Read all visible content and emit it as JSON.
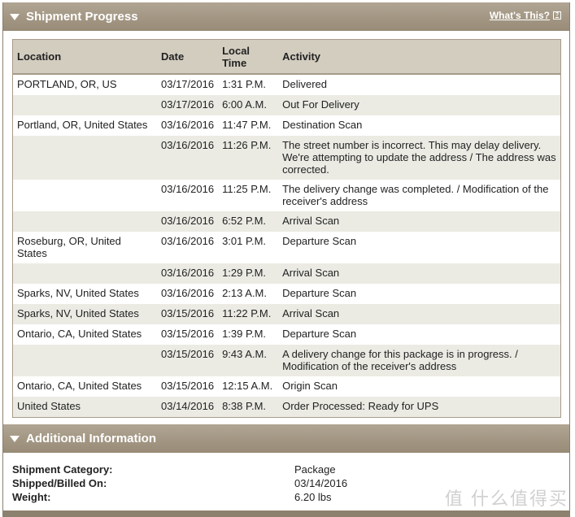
{
  "shipment_progress": {
    "title": "Shipment Progress",
    "whats_this": "What's This?",
    "headers": {
      "location": "Location",
      "date": "Date",
      "time": "Local Time",
      "activity": "Activity"
    },
    "rows": [
      {
        "location": "PORTLAND, OR, US",
        "date": "03/17/2016",
        "time": "1:31 P.M.",
        "activity": "Delivered"
      },
      {
        "location": "",
        "date": "03/17/2016",
        "time": "6:00 A.M.",
        "activity": "Out For Delivery"
      },
      {
        "location": "Portland, OR, United States",
        "date": "03/16/2016",
        "time": "11:47 P.M.",
        "activity": "Destination Scan"
      },
      {
        "location": "",
        "date": "03/16/2016",
        "time": "11:26 P.M.",
        "activity": "The street number is incorrect. This may delay delivery. We're attempting to update the address / The address was corrected."
      },
      {
        "location": "",
        "date": "03/16/2016",
        "time": "11:25 P.M.",
        "activity": "The delivery change was completed. / Modification of the receiver's address"
      },
      {
        "location": "",
        "date": "03/16/2016",
        "time": "6:52 P.M.",
        "activity": "Arrival Scan"
      },
      {
        "location": "Roseburg, OR, United States",
        "date": "03/16/2016",
        "time": "3:01 P.M.",
        "activity": "Departure Scan"
      },
      {
        "location": "",
        "date": "03/16/2016",
        "time": "1:29 P.M.",
        "activity": "Arrival Scan"
      },
      {
        "location": "Sparks, NV, United States",
        "date": "03/16/2016",
        "time": "2:13 A.M.",
        "activity": "Departure Scan"
      },
      {
        "location": "Sparks, NV, United States",
        "date": "03/15/2016",
        "time": "11:22 P.M.",
        "activity": "Arrival Scan"
      },
      {
        "location": "Ontario, CA, United States",
        "date": "03/15/2016",
        "time": "1:39 P.M.",
        "activity": "Departure Scan"
      },
      {
        "location": "",
        "date": "03/15/2016",
        "time": "9:43 A.M.",
        "activity": "A delivery change for this package is in progress. / Modification of the receiver's address"
      },
      {
        "location": "Ontario, CA, United States",
        "date": "03/15/2016",
        "time": "12:15 A.M.",
        "activity": "Origin Scan"
      },
      {
        "location": "United States",
        "date": "03/14/2016",
        "time": "8:38 P.M.",
        "activity": "Order Processed: Ready for UPS"
      }
    ]
  },
  "additional_info": {
    "title": "Additional Information",
    "fields": [
      {
        "label": "Shipment Category:",
        "value": "Package"
      },
      {
        "label": "Shipped/Billed On:",
        "value": "03/14/2016"
      },
      {
        "label": "Weight:",
        "value": "6.20 lbs"
      }
    ]
  },
  "watermark": "值 什么值得买"
}
